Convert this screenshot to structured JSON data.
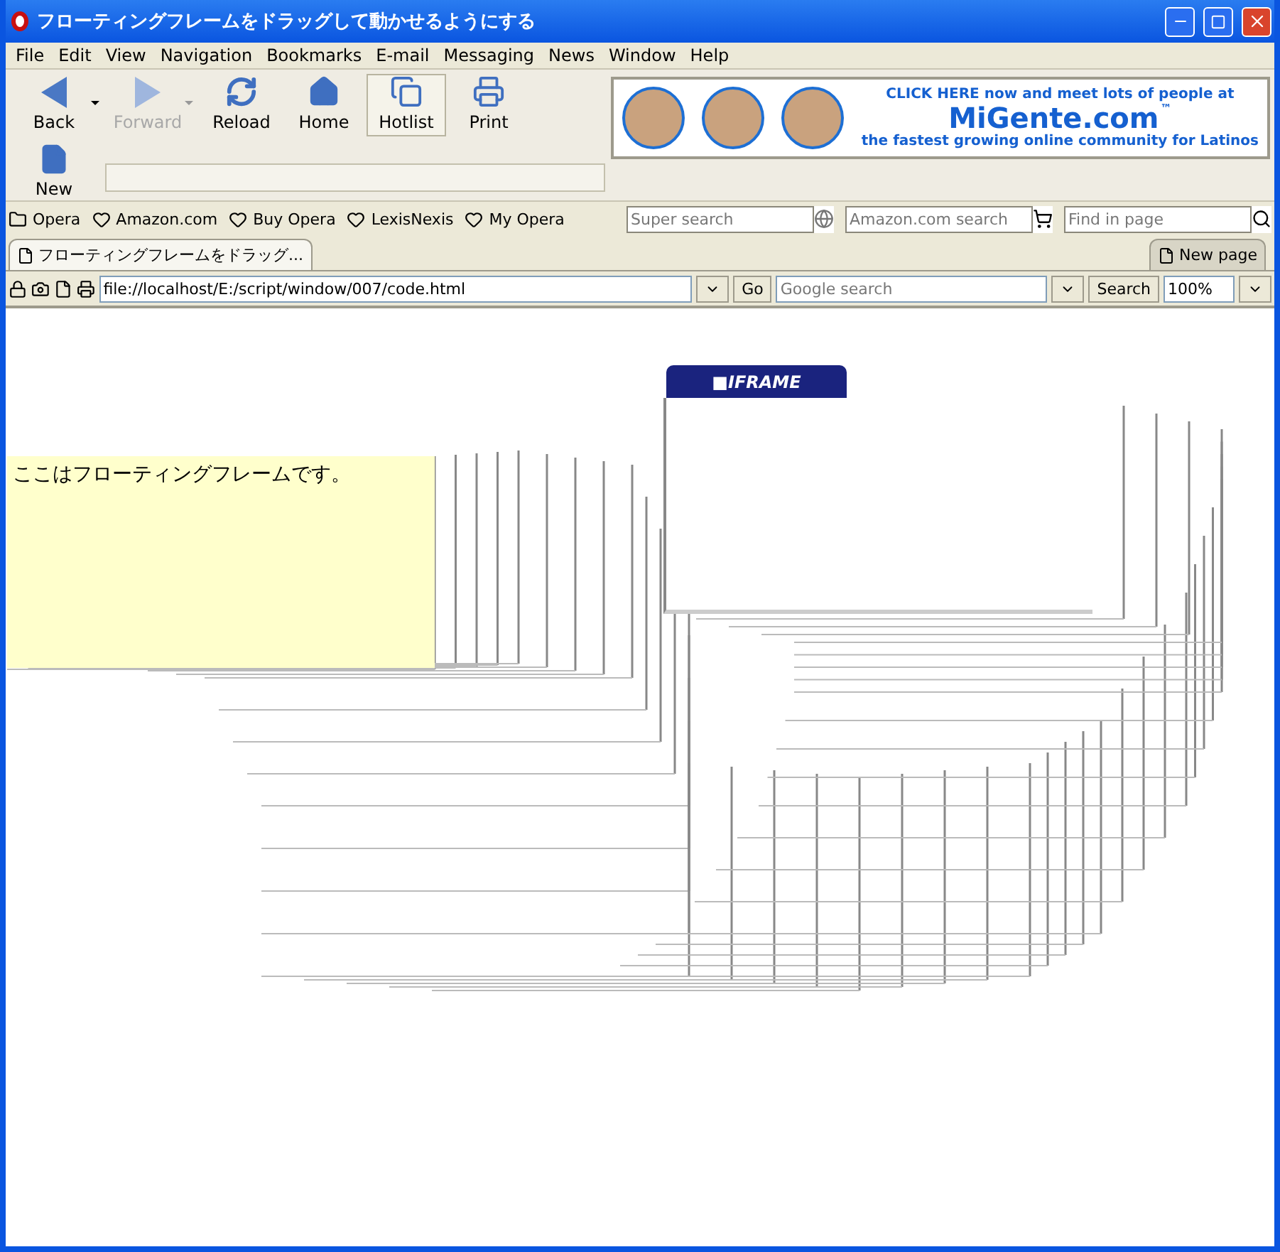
{
  "window": {
    "title": "フローティングフレームをドラッグして動かせるようにする"
  },
  "menu": [
    "File",
    "Edit",
    "View",
    "Navigation",
    "Bookmarks",
    "E-mail",
    "Messaging",
    "News",
    "Window",
    "Help"
  ],
  "toolbar": [
    {
      "kind": "back",
      "label": "Back",
      "disabled": false,
      "pressed": false,
      "has_menu": true
    },
    {
      "kind": "forward",
      "label": "Forward",
      "disabled": true,
      "pressed": false,
      "has_menu": true
    },
    {
      "kind": "reload",
      "label": "Reload",
      "disabled": false,
      "pressed": false,
      "has_menu": false
    },
    {
      "kind": "home",
      "label": "Home",
      "disabled": false,
      "pressed": false,
      "has_menu": false
    },
    {
      "kind": "hotlist",
      "label": "Hotlist",
      "disabled": false,
      "pressed": true,
      "has_menu": false
    },
    {
      "kind": "print",
      "label": "Print",
      "disabled": false,
      "pressed": false,
      "has_menu": false
    }
  ],
  "toolbar_second": {
    "kind": "new",
    "label": "New"
  },
  "ad_banner": {
    "headline": "CLICK HERE now and meet lots of people at",
    "brand": "MiGente.com",
    "brand_mark": "™",
    "tagline": "the fastest growing online community for Latinos"
  },
  "bookmarks": [
    {
      "kind": "folder",
      "label": "Opera"
    },
    {
      "kind": "bookmark",
      "label": "Amazon.com"
    },
    {
      "kind": "bookmark",
      "label": "Buy Opera"
    },
    {
      "kind": "bookmark",
      "label": "LexisNexis"
    },
    {
      "kind": "bookmark",
      "label": "My Opera"
    }
  ],
  "search_fields": [
    {
      "kind": "super",
      "placeholder": "Super search"
    },
    {
      "kind": "amazon",
      "placeholder": "Amazon.com search"
    },
    {
      "kind": "find",
      "placeholder": "Find in page"
    }
  ],
  "tabs": [
    {
      "label": "フローティングフレームをドラッグ...",
      "selected": true
    },
    {
      "label": "New page",
      "selected": false
    }
  ],
  "address_bar": {
    "url": "file://localhost/E:/script/window/007/code.html",
    "go": "Go",
    "search_placeholder": "Google search",
    "search_button": "Search",
    "zoom": "100%"
  },
  "page": {
    "floating_text": "ここはフローティングフレームです。",
    "iframe_tab": "■IFRAME"
  }
}
